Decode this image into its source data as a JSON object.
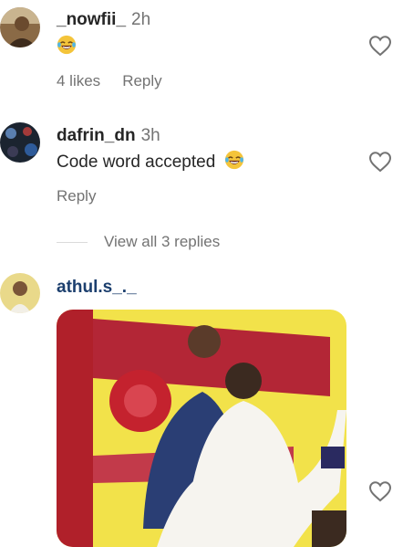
{
  "comments": [
    {
      "username": "_nowfii_",
      "time": "2h",
      "text": "",
      "emoji": "laughing-with-tears",
      "likes": "4 likes",
      "reply": "Reply"
    },
    {
      "username": "dafrin_dn",
      "time": "3h",
      "text": "Code word accepted",
      "emoji": "laughing-with-tears",
      "reply": "Reply"
    },
    {
      "username": "athul.s_._",
      "media": "photo-of-man-in-white-shirt-dancing"
    }
  ],
  "view_replies": "View all 3 replies",
  "colors": {
    "username_link": "#1c3f6e",
    "secondary_text": "#737373",
    "heart_outline": "#737373"
  },
  "icons": {
    "like": "heart-outline-icon",
    "emoji": "laughing-emoji-icon"
  }
}
